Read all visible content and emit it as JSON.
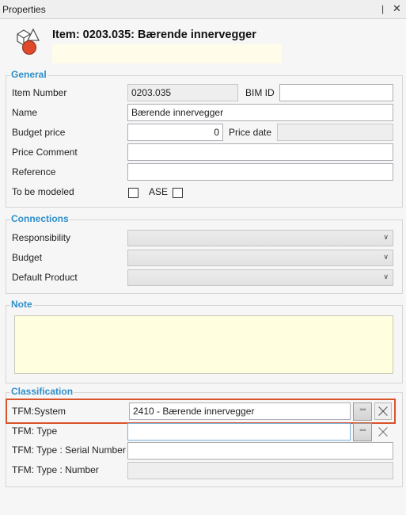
{
  "panel": {
    "title": "Properties",
    "pin_glyph": "❘",
    "close_glyph": "✕"
  },
  "item": {
    "heading": "Item: 0203.035: Bærende innervegger",
    "icon": "item-shapes-icon"
  },
  "general": {
    "title": "General",
    "item_number_label": "Item Number",
    "item_number_value": "0203.035",
    "bim_id_label": "BIM ID",
    "bim_id_value": "",
    "name_label": "Name",
    "name_value": "Bærende innervegger",
    "budget_price_label": "Budget price",
    "budget_price_value": "0",
    "price_date_label": "Price date",
    "price_date_value": "",
    "price_comment_label": "Price Comment",
    "price_comment_value": "",
    "reference_label": "Reference",
    "reference_value": "",
    "to_be_modeled_label": "To be modeled",
    "to_be_modeled_checked": false,
    "ase_label": "ASE",
    "ase_checked": false
  },
  "connections": {
    "title": "Connections",
    "responsibility_label": "Responsibility",
    "budget_label": "Budget",
    "default_product_label": "Default Product",
    "chevron": "∨"
  },
  "note": {
    "title": "Note",
    "value": ""
  },
  "classification": {
    "title": "Classification",
    "tfm_system_label": "TFM:System",
    "tfm_system_value": "2410 - Bærende innervegger",
    "tfm_type_label": "TFM: Type",
    "tfm_type_value": "",
    "tfm_serial_label": "TFM: Type : Serial Number",
    "tfm_serial_value": "",
    "tfm_number_label": "TFM: Type : Number",
    "tfm_number_value": "",
    "ellipsis": "◦◦◦",
    "accent_color": "#d9542b"
  },
  "colors": {
    "section_title": "#2d8ecb",
    "note_background": "#fffedf",
    "highlight": "#d9542b"
  }
}
